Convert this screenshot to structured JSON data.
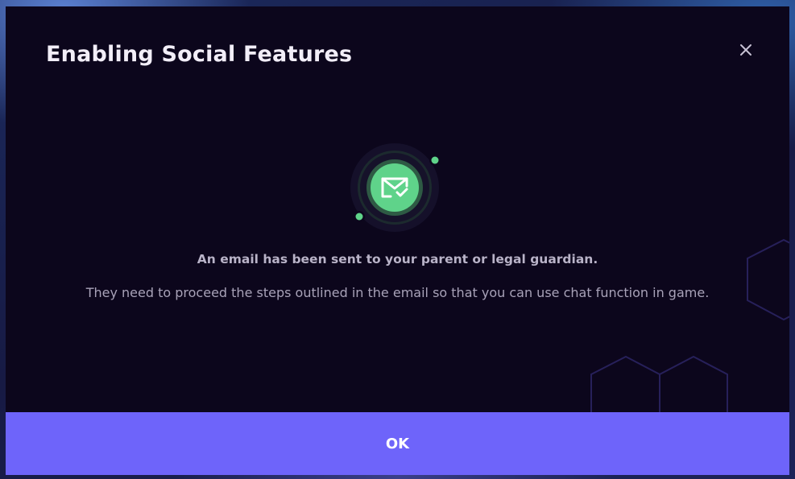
{
  "dialog": {
    "title": "Enabling Social Features",
    "message": "An email has been sent to your parent or legal guardian.",
    "detail": "They need to proceed the steps outlined in the email so that you can use chat function in game.",
    "ok_label": "OK"
  },
  "icons": {
    "close": "close-icon",
    "status": "email-sent-check-icon"
  },
  "colors": {
    "modal_background": "#0c061c",
    "accent_green": "#5fd38a",
    "button_purple": "#6e64fa",
    "decor_hex": "#27205a"
  }
}
